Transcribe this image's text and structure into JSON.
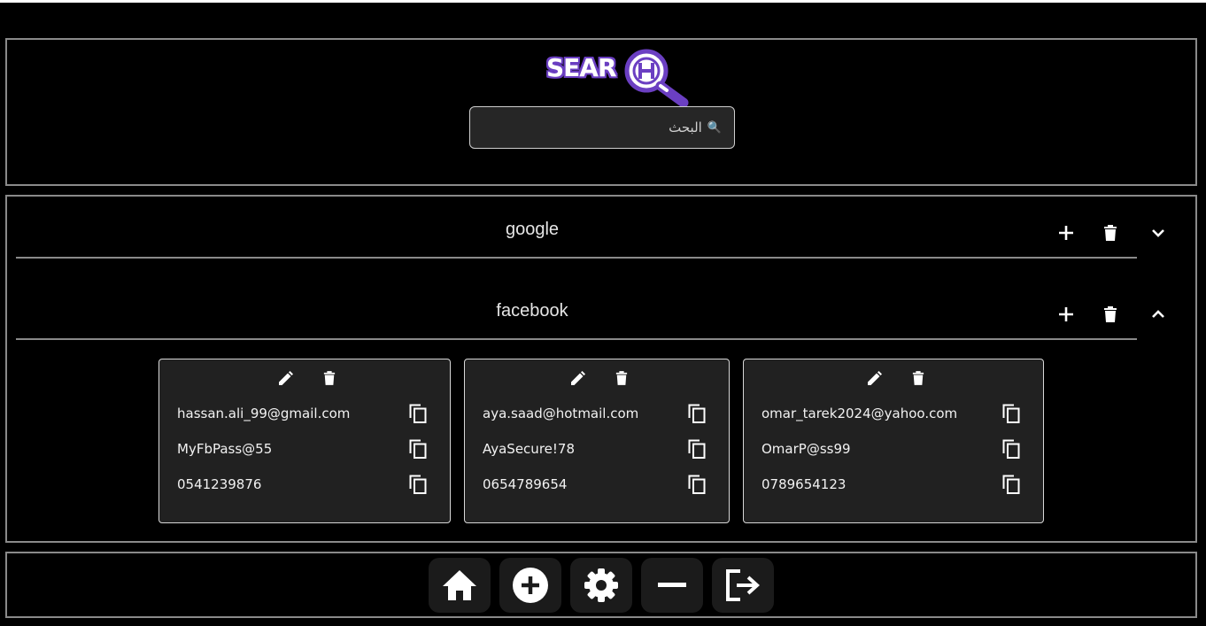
{
  "header": {
    "logo_text": "SEAR",
    "search": {
      "placeholder": "البحث",
      "value": ""
    }
  },
  "groups": [
    {
      "name": "google",
      "expanded": false
    },
    {
      "name": "facebook",
      "expanded": true
    }
  ],
  "accounts": [
    {
      "email": "hassan.ali_99@gmail.com",
      "password": "MyFbPass@55",
      "phone": "0541239876"
    },
    {
      "email": "aya.saad@hotmail.com",
      "password": "AyaSecure!78",
      "phone": "0654789654"
    },
    {
      "email": "omar_tarek2024@yahoo.com",
      "password": "OmarP@ss99",
      "phone": "0789654123"
    }
  ],
  "footer_nav": [
    "home-icon",
    "add-circle-icon",
    "settings-icon",
    "minus-icon",
    "logout-icon"
  ],
  "colors": {
    "background": "#000000",
    "card": "#212121",
    "brand": "#6b3fc2",
    "panel_border": "#8a8a8a"
  }
}
